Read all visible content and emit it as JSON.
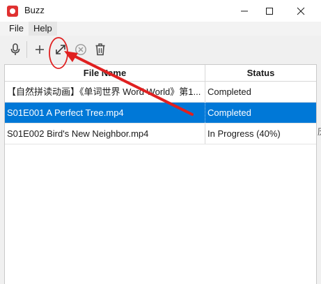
{
  "window": {
    "title": "Buzz",
    "controls": [
      "minimize",
      "maximize",
      "close"
    ]
  },
  "menu": {
    "items": [
      "File",
      "Help"
    ]
  },
  "toolbar": {
    "buttons": [
      {
        "name": "record",
        "icon": "microphone-icon"
      },
      {
        "name": "import",
        "icon": "plus-icon"
      },
      {
        "name": "open-transcript",
        "icon": "expand-arrow-icon"
      },
      {
        "name": "cancel",
        "icon": "cancel-circle-icon"
      },
      {
        "name": "delete",
        "icon": "trash-icon"
      }
    ]
  },
  "table": {
    "columns": [
      "File Name",
      "Status"
    ],
    "rows": [
      {
        "file_name": "【自然拼读动画】《单词世界 Word World》第1...",
        "status": "Completed",
        "selected": false
      },
      {
        "file_name": "S01E001 A Perfect Tree.mp4",
        "status": "Completed",
        "selected": true
      },
      {
        "file_name": "S01E002 Bird's New Neighbor.mp4",
        "status": "In Progress (40%)",
        "selected": false
      }
    ]
  },
  "overflow_glyph": "历",
  "colors": {
    "selection": "#0078d7",
    "annotation": "#e02020",
    "app_icon": "#e03131"
  }
}
